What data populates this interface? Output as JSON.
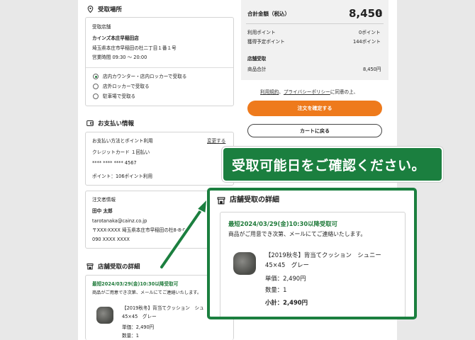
{
  "pickup_location": {
    "title": "受取場所",
    "store_label": "受取店舗",
    "store_name": "カインズ本庄早稲田店",
    "store_address": "埼玉県本庄市早稲田の杜二丁目１番１号",
    "store_hours": "営業時間 09:30 〜 20:00",
    "options": [
      {
        "label": "店内カウンター・店内ロッカーで受取る",
        "selected": true
      },
      {
        "label": "店外ロッカーで受取る",
        "selected": false
      },
      {
        "label": "駐車場で受取る",
        "selected": false
      }
    ]
  },
  "payment": {
    "title": "お支払い情報",
    "method_label": "お支払い方法とポイント利用",
    "change_link": "変更する",
    "card": "クレジットカード １回払い",
    "card_number": "**** **** **** 4567",
    "points": "ポイント：106ポイント利用"
  },
  "orderer": {
    "label": "注文者情報",
    "name": "田中 太郎",
    "email": "tarotanaka@cainz.co.jp",
    "address": "〒XXX-XXXX 埼玉県本庄市早稲田の杜8-8-8",
    "phone": "090 XXXX XXXX"
  },
  "pickup_details": {
    "title": "店舗受取の詳細",
    "date": "最短2024/03/29(金)10:30以降受取可",
    "note": "商品がご用意でき次第、メールにてご連絡いたします。",
    "item_name_1": "【2019秋冬】背当てクッション　シュニー",
    "item_name_2": "45×45　グレー",
    "item_name_short": "【2019秋冬】背当てクッション　シュ",
    "unit_price": "単価：2,490円",
    "quantity": "数量：1",
    "subtotal": "小計：2,490円"
  },
  "summary": {
    "total_label": "合計金額（税込）",
    "total_value": "8,450",
    "yen": "円",
    "points_used_label": "利用ポイント",
    "points_used_value": "0ポイント",
    "points_earn_label": "獲得予定ポイント",
    "points_earn_value": "144ポイント",
    "section_label": "店舗受取",
    "subtotal_label": "商品合計",
    "subtotal_value": "8,450円"
  },
  "agreement": {
    "terms": "利用規約",
    "sep": "、",
    "privacy": "プライバシーポリシー",
    "suffix": "に同意の上、"
  },
  "buttons": {
    "confirm": "注文を確定する",
    "back": "カートに戻る"
  },
  "callout": {
    "banner": "受取可能日をご確認ください。"
  },
  "colors": {
    "accent_green": "#1b7f3f",
    "confirm_orange": "#ee7a1c"
  }
}
